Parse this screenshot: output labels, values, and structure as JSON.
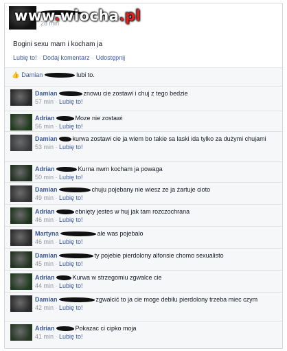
{
  "post": {
    "watermark": {
      "part1": "www",
      "part2": "wiocha",
      "part3": "pl"
    },
    "time": "28 min",
    "text": "Bogini sexu mam i kocham ja",
    "actions": [
      "Lubię to!",
      "Dodaj komentarz",
      "Udostępnij"
    ]
  },
  "likes": {
    "name": "Damian",
    "suffix": "lubi to."
  },
  "like_label": "Lubię to!",
  "comments": [
    {
      "author": "Damian",
      "text": "znowu cie zostawi i chuj z tego bedzie",
      "time": "57 min"
    },
    {
      "author": "Adrian",
      "text": "Moze nie zostawi",
      "time": "56 min"
    },
    {
      "author": "Damian",
      "text": "kurwa zostawi cie ja wiem bo takie sa laski ida tylko za dużymi chujami",
      "time": "53 min"
    },
    {
      "author": "Adrian",
      "text": "Kurna nwm kocham ja powaga",
      "time": "50 min"
    },
    {
      "author": "Damian",
      "text": "chuju pojebany nie wiesz ze ja żartuje cioto",
      "time": "49 min"
    },
    {
      "author": "Adrian",
      "text": "ebnięty jestes w huj jak tam rozczochrana",
      "time": "46 min"
    },
    {
      "author": "Martyna",
      "text": "ale was pojebalo",
      "time": "46 min"
    },
    {
      "author": "Damian",
      "text": "ty pojebie pierdolony alfonsie chomo sexualisto",
      "time": "45 min"
    },
    {
      "author": "Adrian",
      "text": "Kurwa w strzegomiu zgwalce cie",
      "time": "44 min"
    },
    {
      "author": "Damian",
      "text": "zgwałcić to ja cie moge debilu pierdolony trzeba miec czym",
      "time": "42 min"
    },
    {
      "author": "Adrian",
      "text": "Pokazac ci cipko moja",
      "time": "41 min"
    }
  ],
  "colors": {
    "link": "#3b5998",
    "meta": "#9197a3",
    "feedback_bg": "#f6f7f9",
    "watermark_red": "#e12020"
  }
}
